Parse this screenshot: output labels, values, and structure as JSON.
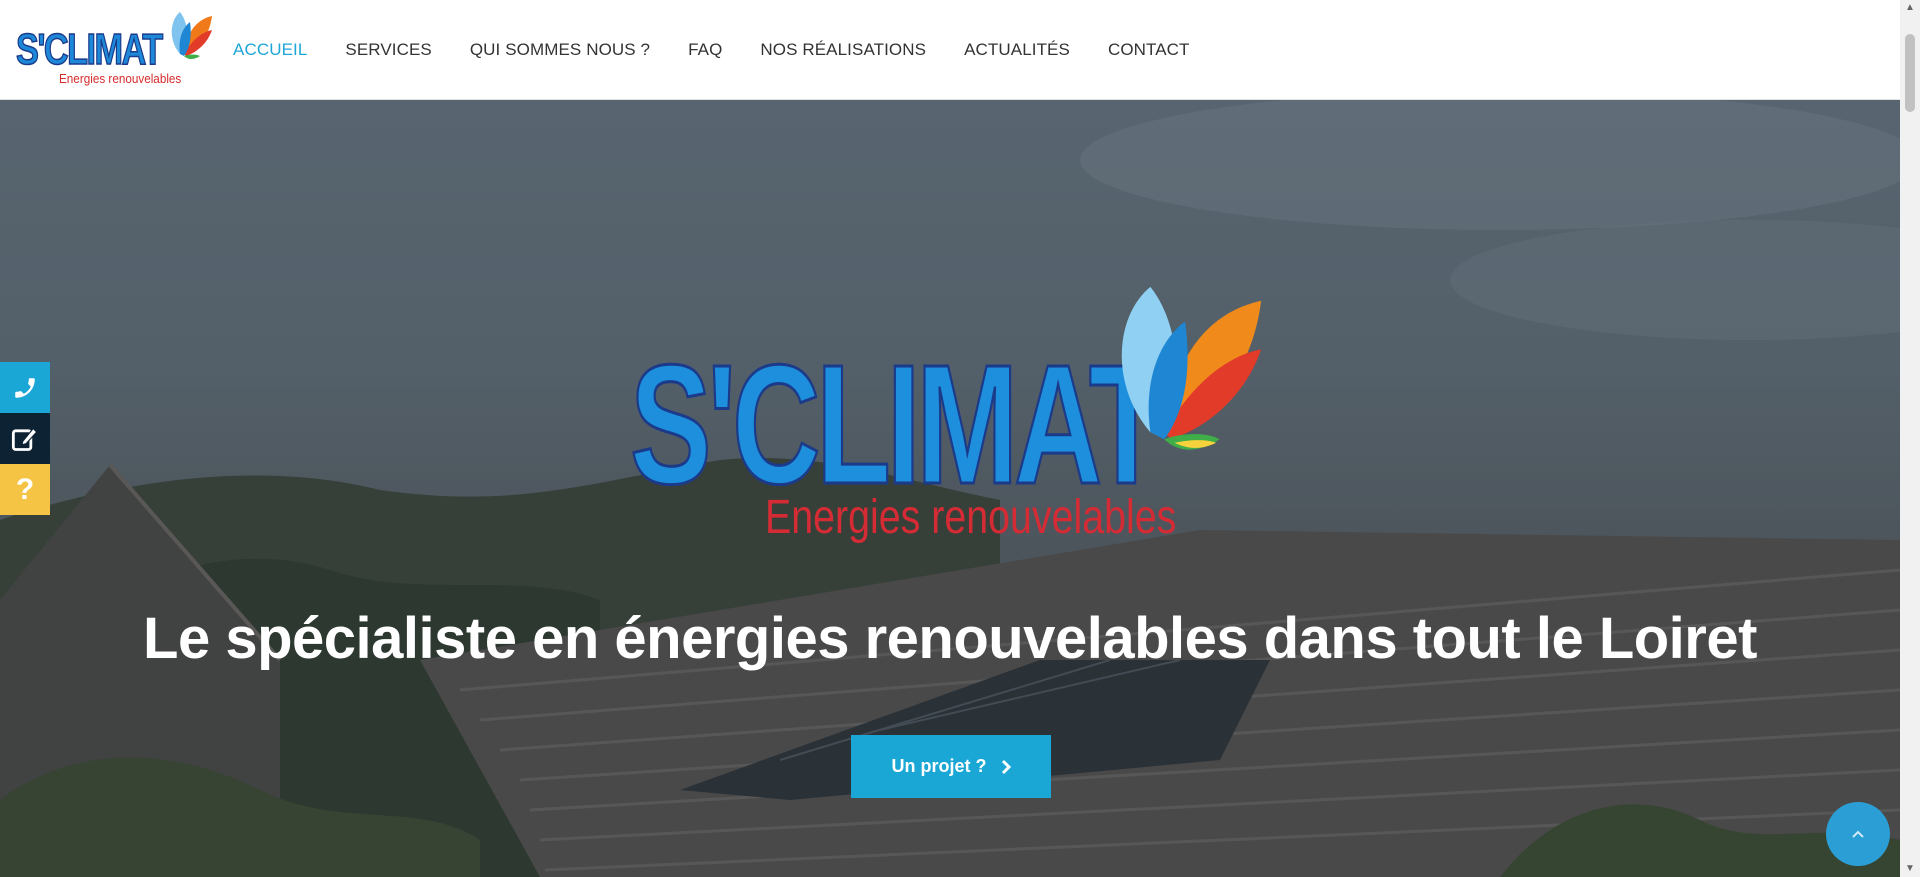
{
  "header": {
    "logo": {
      "brand": "S'CLIMAT",
      "tagline": "Energies renouvelables"
    },
    "nav": [
      {
        "label": "ACCUEIL",
        "active": true
      },
      {
        "label": "SERVICES",
        "active": false
      },
      {
        "label": "QUI SOMMES NOUS ?",
        "active": false
      },
      {
        "label": "FAQ",
        "active": false
      },
      {
        "label": "NOS RÉALISATIONS",
        "active": false
      },
      {
        "label": "ACTUALITÉS",
        "active": false
      },
      {
        "label": "CONTACT",
        "active": false
      }
    ]
  },
  "hero": {
    "logo": {
      "brand": "S'CLIMAT",
      "tagline": "Energies renouvelables"
    },
    "title": "Le spécialiste en énergies renouvelables dans tout le Loiret",
    "cta_label": "Un projet ?"
  },
  "side_buttons": [
    {
      "icon": "phone-icon",
      "color": "#1ba7d6"
    },
    {
      "icon": "edit-icon",
      "color": "#0d2233"
    },
    {
      "icon": "question-icon",
      "color": "#f6c445"
    }
  ],
  "colors": {
    "accent": "#1ba7d6",
    "nav_active": "#1ea6d9",
    "brand_blue": "#1e8fdc",
    "brand_red": "#d52b35"
  }
}
